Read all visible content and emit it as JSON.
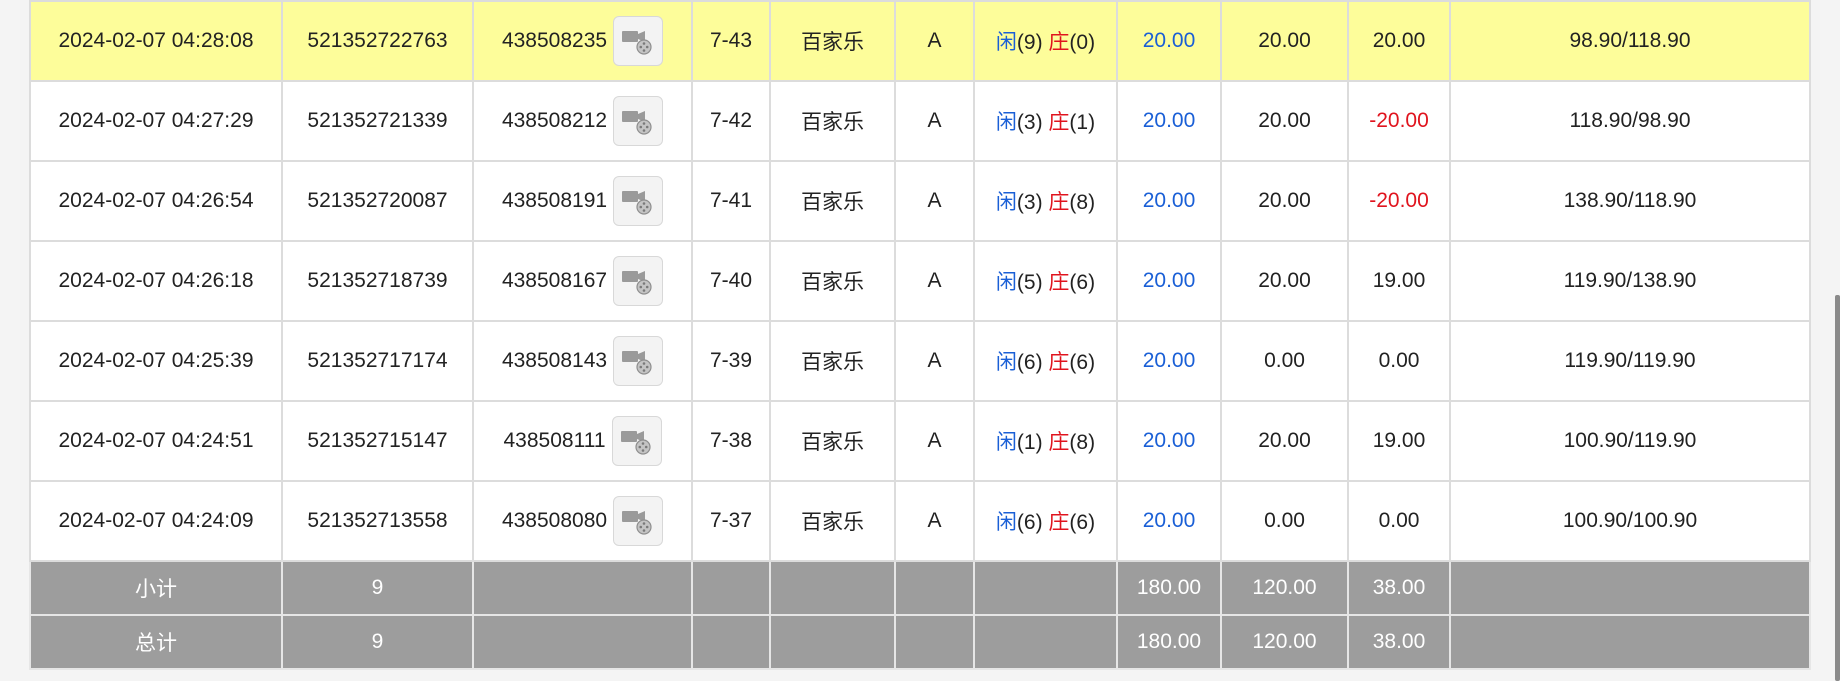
{
  "rows": [
    {
      "time": "2024-02-07 04:28:08",
      "bet_id": "521352722763",
      "game_id": "438508235",
      "round": "7-43",
      "game": "百家乐",
      "table": "A",
      "player_label": "闲",
      "player_score": "(9)",
      "banker_label": "庄",
      "banker_score": "(0)",
      "bet": "20.00",
      "valid": "20.00",
      "win": "20.00",
      "balance": "98.90/118.90",
      "highlight": true,
      "win_negative": false
    },
    {
      "time": "2024-02-07 04:27:29",
      "bet_id": "521352721339",
      "game_id": "438508212",
      "round": "7-42",
      "game": "百家乐",
      "table": "A",
      "player_label": "闲",
      "player_score": "(3)",
      "banker_label": "庄",
      "banker_score": "(1)",
      "bet": "20.00",
      "valid": "20.00",
      "win": "-20.00",
      "balance": "118.90/98.90",
      "highlight": false,
      "win_negative": true
    },
    {
      "time": "2024-02-07 04:26:54",
      "bet_id": "521352720087",
      "game_id": "438508191",
      "round": "7-41",
      "game": "百家乐",
      "table": "A",
      "player_label": "闲",
      "player_score": "(3)",
      "banker_label": "庄",
      "banker_score": "(8)",
      "bet": "20.00",
      "valid": "20.00",
      "win": "-20.00",
      "balance": "138.90/118.90",
      "highlight": false,
      "win_negative": true
    },
    {
      "time": "2024-02-07 04:26:18",
      "bet_id": "521352718739",
      "game_id": "438508167",
      "round": "7-40",
      "game": "百家乐",
      "table": "A",
      "player_label": "闲",
      "player_score": "(5)",
      "banker_label": "庄",
      "banker_score": "(6)",
      "bet": "20.00",
      "valid": "20.00",
      "win": "19.00",
      "balance": "119.90/138.90",
      "highlight": false,
      "win_negative": false
    },
    {
      "time": "2024-02-07 04:25:39",
      "bet_id": "521352717174",
      "game_id": "438508143",
      "round": "7-39",
      "game": "百家乐",
      "table": "A",
      "player_label": "闲",
      "player_score": "(6)",
      "banker_label": "庄",
      "banker_score": "(6)",
      "bet": "20.00",
      "valid": "0.00",
      "win": "0.00",
      "balance": "119.90/119.90",
      "highlight": false,
      "win_negative": false
    },
    {
      "time": "2024-02-07 04:24:51",
      "bet_id": "521352715147",
      "game_id": "438508111",
      "round": "7-38",
      "game": "百家乐",
      "table": "A",
      "player_label": "闲",
      "player_score": "(1)",
      "banker_label": "庄",
      "banker_score": "(8)",
      "bet": "20.00",
      "valid": "20.00",
      "win": "19.00",
      "balance": "100.90/119.90",
      "highlight": false,
      "win_negative": false
    },
    {
      "time": "2024-02-07 04:24:09",
      "bet_id": "521352713558",
      "game_id": "438508080",
      "round": "7-37",
      "game": "百家乐",
      "table": "A",
      "player_label": "闲",
      "player_score": "(6)",
      "banker_label": "庄",
      "banker_score": "(6)",
      "bet": "20.00",
      "valid": "0.00",
      "win": "0.00",
      "balance": "100.90/100.90",
      "highlight": false,
      "win_negative": false
    }
  ],
  "subtotal": {
    "label": "小计",
    "count": "9",
    "bet": "180.00",
    "valid": "120.00",
    "win": "38.00"
  },
  "total": {
    "label": "总计",
    "count": "9",
    "bet": "180.00",
    "valid": "120.00",
    "win": "38.00"
  },
  "icons": {
    "replay": "video-replay-icon"
  },
  "colors": {
    "highlight_row": "#fdfd9a",
    "player": "#1a5fd6",
    "banker": "#e0141e",
    "total_bg": "#9d9d9d"
  }
}
